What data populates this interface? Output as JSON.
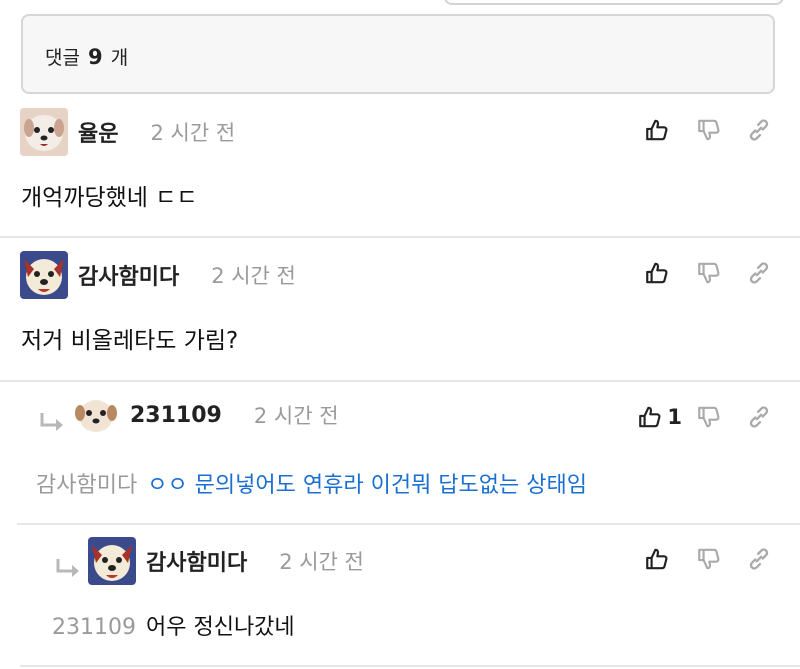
{
  "comment_count": {
    "prefix": "댓글",
    "number": "9",
    "suffix": "개"
  },
  "comments": [
    {
      "author": "율운",
      "time": "2 시간 전",
      "text": "개억까당했네 ㄷㄷ",
      "likes": ""
    },
    {
      "author": "감사함미다",
      "time": "2 시간 전",
      "text": "저거 비올레타도 가림?",
      "likes": ""
    },
    {
      "author": "231109",
      "time": "2 시간 전",
      "mention": "감사함미다",
      "text": "ㅇㅇ 문의넣어도 연휴라 이건뭐 답도없는 상태임",
      "likes": "1"
    },
    {
      "author": "감사함미다",
      "time": "2 시간 전",
      "mention": "231109",
      "text": "어우 정신나갔네",
      "likes": ""
    }
  ],
  "icons": {
    "like": "thumbs-up-icon",
    "dislike": "thumbs-down-icon",
    "link": "link-icon",
    "reply": "reply-arrow-icon"
  },
  "colors": {
    "text_blue": "#1a6fd1",
    "meta_gray": "#9a9a9a",
    "border": "#d6d6d6"
  }
}
